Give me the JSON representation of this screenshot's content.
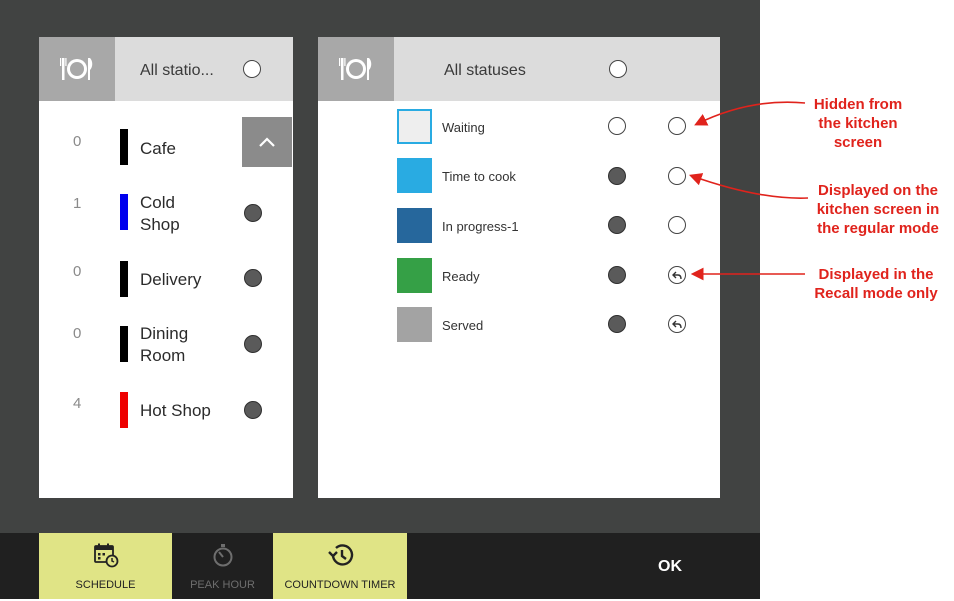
{
  "stations_panel": {
    "title": "All statio...",
    "icon": "dining-plate-icon",
    "stations": [
      {
        "count": "0",
        "name": "Cafe",
        "color": "#000000",
        "selected": false
      },
      {
        "count": "1",
        "name": "Cold Shop",
        "color": "#0000ee",
        "selected": true
      },
      {
        "count": "0",
        "name": "Delivery",
        "color": "#000000",
        "selected": true
      },
      {
        "count": "0",
        "name": "Dining Room",
        "color": "#000000",
        "selected": true
      },
      {
        "count": "4",
        "name": "Hot Shop",
        "color": "#ee0000",
        "selected": true
      }
    ],
    "scroll_icon": "chevron-up-icon"
  },
  "statuses_panel": {
    "title": "All statuses",
    "icon": "dining-plate-icon",
    "statuses": [
      {
        "name": "Waiting",
        "color": "#eeeeee",
        "selected": false,
        "visibility": "hidden"
      },
      {
        "name": "Time to cook",
        "color": "#29abe2",
        "selected": true,
        "visibility": "regular"
      },
      {
        "name": "In progress-1",
        "color": "#26679c",
        "selected": true,
        "visibility": "regular"
      },
      {
        "name": "Ready",
        "color": "#35a046",
        "selected": true,
        "visibility": "recall"
      },
      {
        "name": "Served",
        "color": "#a3a3a3",
        "selected": true,
        "visibility": "recall"
      }
    ]
  },
  "annotations": {
    "hidden": "Hidden from the kitchen screen",
    "regular": "Displayed on the kitchen screen in the regular mode",
    "recall": "Displayed in the Recall mode only",
    "color": "#e0231c"
  },
  "toolbar": {
    "schedule": {
      "label": "SCHEDULE",
      "icon": "calendar-clock-icon",
      "active": true
    },
    "peak_hour": {
      "label": "PEAK HOUR",
      "icon": "stopwatch-icon",
      "active": false
    },
    "countdown_timer": {
      "label": "COUNTDOWN TIMER",
      "icon": "history-clock-icon",
      "active": true
    },
    "ok_label": "OK"
  }
}
